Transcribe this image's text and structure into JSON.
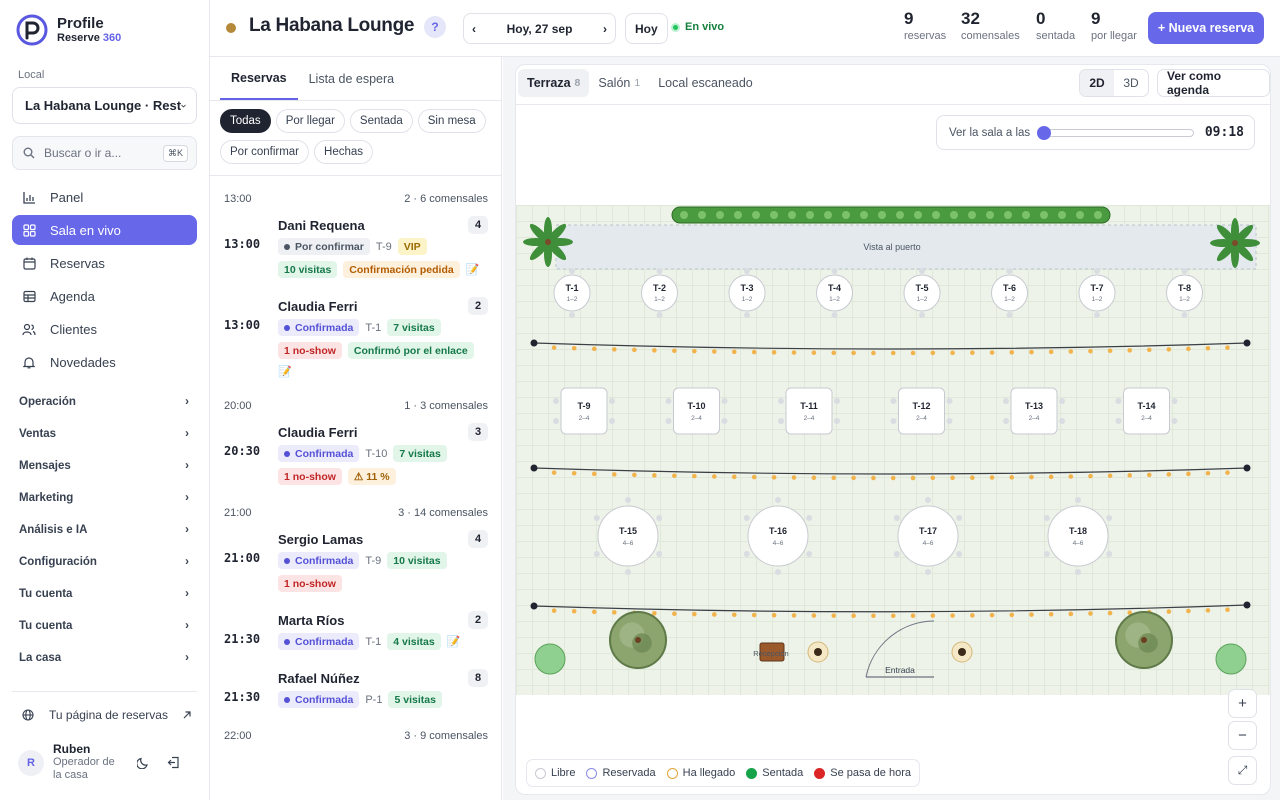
{
  "brand": {
    "name": "Profile",
    "sub_prefix": "Reserve ",
    "sub_highlight": "360"
  },
  "sidebar": {
    "local_label": "Local",
    "local_value": "La Habana Lounge · Rest",
    "search_placeholder": "Buscar o ir a...",
    "search_shortcut": "⌘K",
    "nav": [
      {
        "label": "Panel",
        "icon": "chart-icon"
      },
      {
        "label": "Sala en vivo",
        "icon": "grid-icon",
        "active": true
      },
      {
        "label": "Reservas",
        "icon": "calendar-icon"
      },
      {
        "label": "Agenda",
        "icon": "table-icon"
      },
      {
        "label": "Clientes",
        "icon": "users-icon"
      },
      {
        "label": "Novedades",
        "icon": "bell-icon"
      }
    ],
    "groups": [
      "Operación",
      "Ventas",
      "Mensajes",
      "Marketing",
      "Análisis e IA",
      "Configuración",
      "Tu cuenta",
      "Tu cuenta",
      "La casa"
    ],
    "public_link": "Tu página de reservas",
    "user": {
      "initial": "R",
      "name": "Ruben",
      "role": "Operador de la casa"
    }
  },
  "topbar": {
    "venue": "La Habana Lounge",
    "help": "?",
    "date": "Hoy, 27 sep",
    "today": "Hoy",
    "live": "En vivo",
    "stats": [
      {
        "n": "9",
        "l": "reservas"
      },
      {
        "n": "32",
        "l": "comensales"
      },
      {
        "n": "0",
        "l": "sentada"
      },
      {
        "n": "9",
        "l": "por llegar"
      }
    ],
    "new_reservation": "+ Nueva reserva"
  },
  "list": {
    "tabs": [
      "Reservas",
      "Lista de espera"
    ],
    "filters": [
      "Todas",
      "Por llegar",
      "Sentada",
      "Sin mesa",
      "Por confirmar",
      "Hechas"
    ],
    "groups": [
      {
        "time": "13:00",
        "summary": "2 · 6 comensales",
        "items": [
          {
            "time": "13:00",
            "name": "Dani Requena",
            "party": "4",
            "status": "Por confirmar",
            "status_type": "pend",
            "table": "T-9",
            "tags": [
              {
                "t": "VIP",
                "k": "vip"
              },
              {
                "t": "10 visitas",
                "k": "vis"
              },
              {
                "t": "Confirmación pedida",
                "k": "ped"
              }
            ],
            "note": "📝"
          },
          {
            "time": "13:00",
            "name": "Claudia Ferri",
            "party": "2",
            "status": "Confirmada",
            "status_type": "conf",
            "table": "T-1",
            "tags": [
              {
                "t": "7 visitas",
                "k": "vis"
              },
              {
                "t": "1 no-show",
                "k": "ns"
              },
              {
                "t": "Confirmó por el enlace",
                "k": "enl"
              }
            ],
            "note": "📝"
          }
        ]
      },
      {
        "time": "20:00",
        "summary": "1 · 3 comensales",
        "items": [
          {
            "time": "20:30",
            "name": "Claudia Ferri",
            "party": "3",
            "status": "Confirmada",
            "status_type": "conf",
            "table": "T-10",
            "tags": [
              {
                "t": "7 visitas",
                "k": "vis"
              },
              {
                "t": "1 no-show",
                "k": "ns"
              },
              {
                "t": "⚠ 11 %",
                "k": "warn"
              }
            ],
            "note": ""
          }
        ]
      },
      {
        "time": "21:00",
        "summary": "3 · 14 comensales",
        "items": [
          {
            "time": "21:00",
            "name": "Sergio Lamas",
            "party": "4",
            "status": "Confirmada",
            "status_type": "conf",
            "table": "T-9",
            "tags": [
              {
                "t": "10 visitas",
                "k": "vis"
              },
              {
                "t": "1 no-show",
                "k": "ns"
              }
            ],
            "note": ""
          },
          {
            "time": "21:30",
            "name": "Marta Ríos",
            "party": "2",
            "status": "Confirmada",
            "status_type": "conf",
            "table": "T-1",
            "tags": [
              {
                "t": "4 visitas",
                "k": "vis"
              }
            ],
            "note": "📝"
          },
          {
            "time": "21:30",
            "name": "Rafael Núñez",
            "party": "8",
            "status": "Confirmada",
            "status_type": "conf",
            "table": "P-1",
            "tags": [
              {
                "t": "5 visitas",
                "k": "vis"
              }
            ],
            "note": ""
          }
        ]
      },
      {
        "time": "22:00",
        "summary": "3 · 9 comensales",
        "items": []
      }
    ]
  },
  "map": {
    "tabs": [
      {
        "label": "Terraza",
        "count": "8"
      },
      {
        "label": "Salón",
        "count": "1"
      },
      {
        "label": "Local escaneado",
        "count": ""
      }
    ],
    "view_2d": "2D",
    "view_3d": "3D",
    "agenda": "Ver como agenda",
    "slider_label": "Ver la sala a las",
    "slider_time": "09:18",
    "slider_fraction": 0.0,
    "harbor_label": "Vista al puerto",
    "reception_label": "Recepción",
    "entrance_label": "Entrada",
    "tables_row1": [
      {
        "id": "T-1",
        "cap": "1–2"
      },
      {
        "id": "T-2",
        "cap": "1–2"
      },
      {
        "id": "T-3",
        "cap": "1–2"
      },
      {
        "id": "T-4",
        "cap": "1–2"
      },
      {
        "id": "T-5",
        "cap": "1–2"
      },
      {
        "id": "T-6",
        "cap": "1–2"
      },
      {
        "id": "T-7",
        "cap": "1–2"
      },
      {
        "id": "T-8",
        "cap": "1–2"
      }
    ],
    "tables_row2": [
      {
        "id": "T-9",
        "cap": "2–4"
      },
      {
        "id": "T-10",
        "cap": "2–4"
      },
      {
        "id": "T-11",
        "cap": "2–4"
      },
      {
        "id": "T-12",
        "cap": "2–4"
      },
      {
        "id": "T-13",
        "cap": "2–4"
      },
      {
        "id": "T-14",
        "cap": "2–4"
      }
    ],
    "tables_row3": [
      {
        "id": "T-15",
        "cap": "4–6"
      },
      {
        "id": "T-16",
        "cap": "4–6"
      },
      {
        "id": "T-17",
        "cap": "4–6"
      },
      {
        "id": "T-18",
        "cap": "4–6"
      }
    ],
    "zoom_in": "+",
    "zoom_out": "−",
    "fit": "⤢",
    "legend": [
      {
        "label": "Libre",
        "color": "#ffffff",
        "border": "#c7cad1"
      },
      {
        "label": "Reservada",
        "color": "#ffffff",
        "border": "#8b8ae6"
      },
      {
        "label": "Ha llegado",
        "color": "#ffffff",
        "border": "#e0a53a"
      },
      {
        "label": "Sentada",
        "color": "#16a34a",
        "border": "#16a34a"
      },
      {
        "label": "Se pasa de hora",
        "color": "#dc2626",
        "border": "#dc2626"
      }
    ]
  },
  "colors": {
    "accent": "#6767e9",
    "live": "#22c55e"
  }
}
